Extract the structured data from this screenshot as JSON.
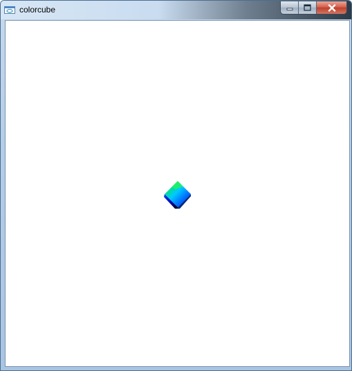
{
  "window": {
    "title": "colorcube",
    "icon": "app-window-icon"
  },
  "controls": {
    "minimize_icon": "minimize-icon",
    "maximize_icon": "maximize-icon",
    "close_icon": "close-icon"
  },
  "canvas": {
    "background": "#ffffff",
    "object": "rotated-color-cube",
    "cube_colors": [
      "#00ff00",
      "#0000ff",
      "#00c0ff",
      "#000000"
    ]
  }
}
